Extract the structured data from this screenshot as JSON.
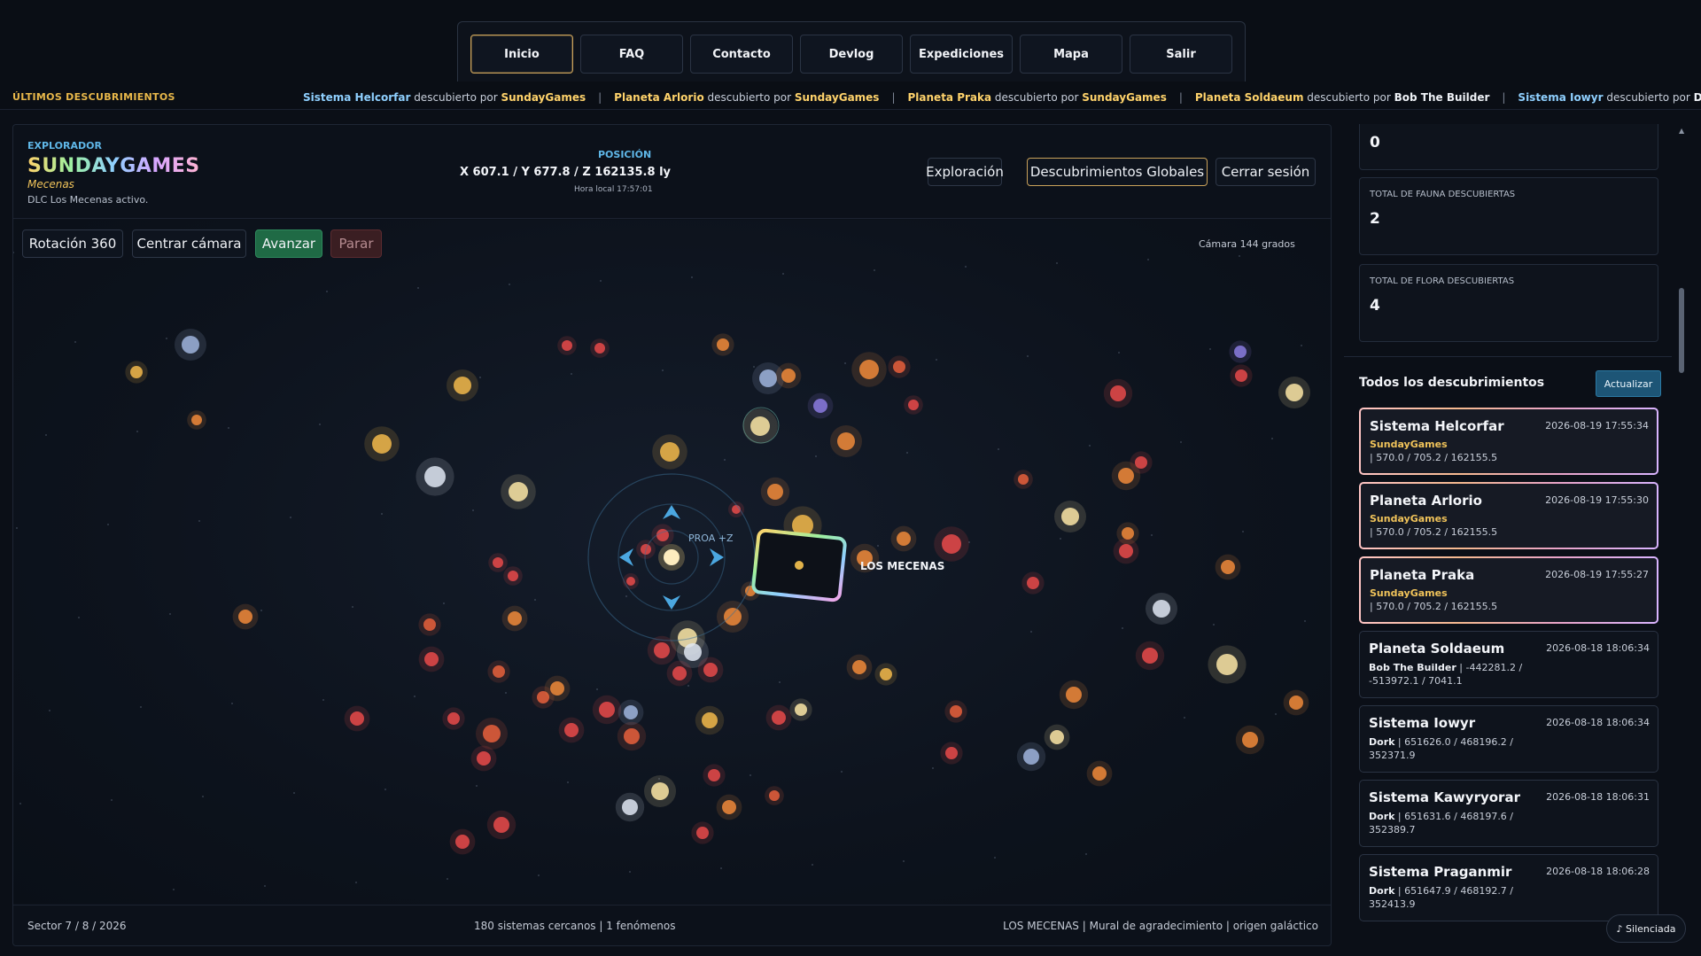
{
  "nav": [
    "Inicio",
    "FAQ",
    "Contacto",
    "Devlog",
    "Expediciones",
    "Mapa",
    "Salir"
  ],
  "ticker": {
    "label": "ÚLTIMOS DESCUBRIMIENTOS",
    "word": "descubierto por",
    "items": [
      {
        "name": "Sistema Helcorfar",
        "author": "SundayGames",
        "color": "#8fd0ff"
      },
      {
        "name": "Planeta Arlorio",
        "author": "SundayGames",
        "color": "#ffd36b"
      },
      {
        "name": "Planeta Praka",
        "author": "SundayGames",
        "color": "#ffd36b"
      },
      {
        "name": "Planeta Soldaeum",
        "author": "Bob The Builder",
        "color": "#ffd36b"
      },
      {
        "name": "Sistema Iowyr",
        "author": "Dork",
        "color": "#8fd0ff"
      }
    ]
  },
  "explorer": {
    "label": "EXPLORADOR",
    "name": "SUNDAYGAMES",
    "rank": "Mecenas",
    "dlc": "DLC Los Mecenas activo."
  },
  "position": {
    "label": "POSICIÓN",
    "value": "X 607.1 / Y 677.8 / Z 162135.8 ly",
    "time": "Hora local 17:57:01"
  },
  "header_buttons": {
    "exploration": "Exploración",
    "global": "Descubrimientos Globales",
    "logout": "Cerrar sesión"
  },
  "controls": {
    "rotate": "Rotación 360",
    "center": "Centrar cámara",
    "forward": "Avanzar",
    "stop": "Parar",
    "camera": "Cámara 144 grados"
  },
  "map": {
    "landmark": "LOS MECENAS",
    "heading": "PROA +Z"
  },
  "footer": {
    "sector": "Sector 7 / 8 / 2026",
    "nearby": "180 sistemas cercanos | 1 fenómenos",
    "info": "LOS MECENAS | Mural de agradecimiento | origen galáctico"
  },
  "stats": [
    {
      "label": "",
      "value": "0"
    },
    {
      "label": "TOTAL DE FAUNA DESCUBIERTAS",
      "value": "2"
    },
    {
      "label": "TOTAL DE FLORA DESCUBIERTAS",
      "value": "4"
    }
  ],
  "discoveries": {
    "title": "Todos los descubrimientos",
    "refresh": "Actualizar",
    "items": [
      {
        "name": "Sistema Helcorfar",
        "date": "2026-08-19 17:55:34",
        "author": "SundayGames",
        "coords": "| 570.0 / 705.2 / 162155.5"
      },
      {
        "name": "Planeta Arlorio",
        "date": "2026-08-19 17:55:30",
        "author": "SundayGames",
        "coords": "| 570.0 / 705.2 / 162155.5"
      },
      {
        "name": "Planeta Praka",
        "date": "2026-08-19 17:55:27",
        "author": "SundayGames",
        "coords": "| 570.0 / 705.2 / 162155.5"
      },
      {
        "name": "Planeta Soldaeum",
        "date": "2026-08-18 18:06:34",
        "author": "Bob The Builder",
        "coords": " | -442281.2 / -513972.1 / 7041.1"
      },
      {
        "name": "Sistema Iowyr",
        "date": "2026-08-18 18:06:34",
        "author": "Dork",
        "coords": " | 651626.0 / 468196.2 / 352371.9"
      },
      {
        "name": "Sistema Kawyryorar",
        "date": "2026-08-18 18:06:31",
        "author": "Dork",
        "coords": " | 651631.6 / 468197.6 / 352389.7"
      },
      {
        "name": "Sistema Praganmir",
        "date": "2026-08-18 18:06:28",
        "author": "Dork",
        "coords": " | 651647.9 / 468192.7 / 352413.9"
      }
    ]
  },
  "mute": "♪ Silenciada",
  "colors": {
    "gold": "#c9a15a",
    "accent_blue": "#5fb7e8",
    "forward_green": "#1f6a45",
    "star_palette": [
      "#e8603c",
      "#f08a3a",
      "#f2b84b",
      "#fbe6a6",
      "#dfe6f2",
      "#9fb4dd",
      "#8b7be0",
      "#e84a4a"
    ]
  },
  "icons": [
    "arrow-up-icon",
    "arrow-down-icon",
    "arrow-left-icon",
    "arrow-right-icon",
    "ship-marker-icon",
    "music-note-icon"
  ]
}
